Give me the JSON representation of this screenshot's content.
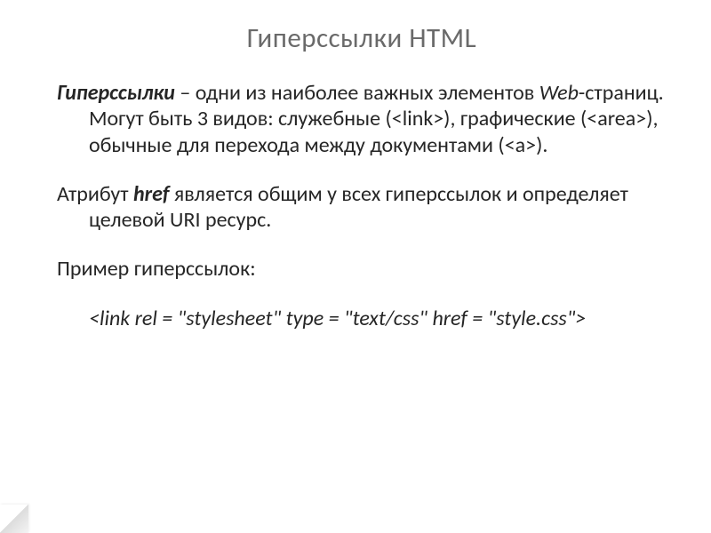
{
  "title": "Гиперссылки HTML",
  "para1": {
    "lead": "Гиперссылки",
    "rest": " – одни из наиболее важных элементов ",
    "web": "Web",
    "rest2": "-страниц. Могут быть 3 видов: служебные (<link>), графические (<area>), обычные для перехода между документами (<a>)."
  },
  "para2": {
    "pre": "Атрибут  ",
    "attr": "href",
    "rest": "  является общим у всех гиперссылок и определяет целевой URI ресурс."
  },
  "para3": "Пример гиперссылок:",
  "code1": "<link rel = \"stylesheet\" type = \"text/css\" href = \"style.css\">"
}
